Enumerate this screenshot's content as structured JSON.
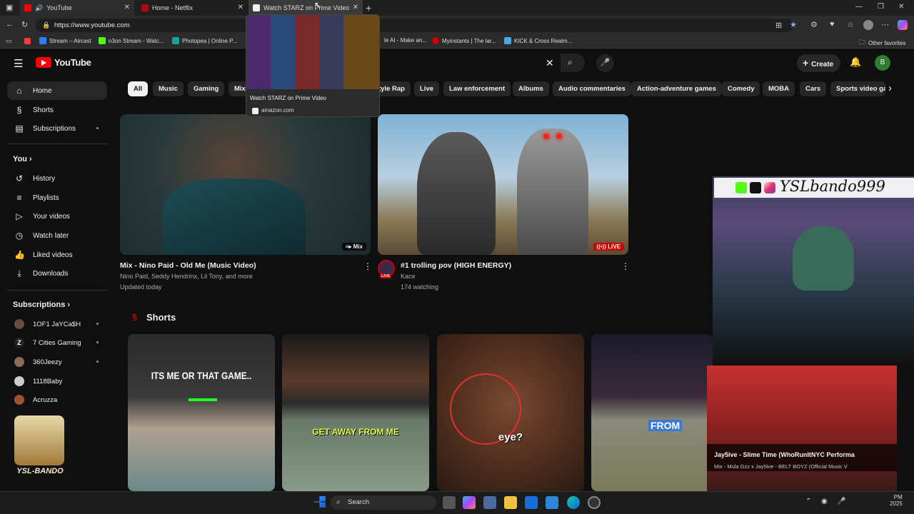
{
  "browser": {
    "tabs": [
      {
        "title": "YouTube"
      },
      {
        "title": "Home - Netflix"
      },
      {
        "title": "Watch STARZ on Prime Video"
      }
    ],
    "url": "https://www.youtube.com",
    "bookmarks": [
      "Stream – Aircast",
      "n3on Stream - Watc...",
      "Photopea | Online P...",
      "le AI - Make an...",
      "Myinstants | The lar...",
      "KICK & Cross Realm..."
    ],
    "other_favorites": "Other favorites",
    "tab_preview": {
      "title": "Watch STARZ on Prime Video",
      "domain": "amazon.com"
    }
  },
  "youtube": {
    "logo": "YouTube",
    "create": "Create",
    "avatar_letter": "B",
    "nav": [
      {
        "label": "Home"
      },
      {
        "label": "Shorts"
      },
      {
        "label": "Subscriptions"
      }
    ],
    "you_heading": "You",
    "you_items": [
      {
        "label": "History"
      },
      {
        "label": "Playlists"
      },
      {
        "label": "Your videos"
      },
      {
        "label": "Watch later"
      },
      {
        "label": "Liked videos"
      },
      {
        "label": "Downloads"
      }
    ],
    "subs_heading": "Subscriptions",
    "subs": [
      {
        "name": "1OF1 JaYCa$H"
      },
      {
        "name": "7 Cities Gaming"
      },
      {
        "name": "360Jeezy"
      },
      {
        "name": "1118Baby"
      },
      {
        "name": "Acruzza"
      }
    ],
    "chips": [
      "All",
      "Music",
      "Gaming",
      "Mix",
      "tyle Rap",
      "Live",
      "Law enforcement",
      "Albums",
      "Audio commentaries",
      "Action-adventure games",
      "Comedy",
      "MOBA",
      "Cars",
      "Sports video gar"
    ],
    "videos": [
      {
        "title": "Mix - Nino Paid - Old Me (Music Video)",
        "channel": "Nino Paid, Seddy Hendrinx, Lil Tony, and more",
        "meta": "Updated today",
        "badge": "Mix"
      },
      {
        "title": "#1 trolling pov  (HIGH ENERGY)",
        "channel": "Kace",
        "meta": "174 watching",
        "badge": "LIVE"
      }
    ],
    "shorts_heading": "Shorts",
    "shorts": [
      {
        "caption": "ITS ME OR THAT GAME.."
      },
      {
        "caption": "GET AWAY FROM ME"
      },
      {
        "caption": "eye?"
      },
      {
        "caption": "FROM"
      }
    ]
  },
  "overlay": {
    "username": "YSLbando999",
    "logo_text": "YSL-BANDO",
    "mini_title": "Jay5ive - Slime Time (WhoRunItNYC Performa",
    "mini_sub": "Mix - Mula Gzz x Jay5ive - BELT BOYZ (Official Music V"
  },
  "taskbar": {
    "search": "Search",
    "time": "PM",
    "date": "2025"
  }
}
